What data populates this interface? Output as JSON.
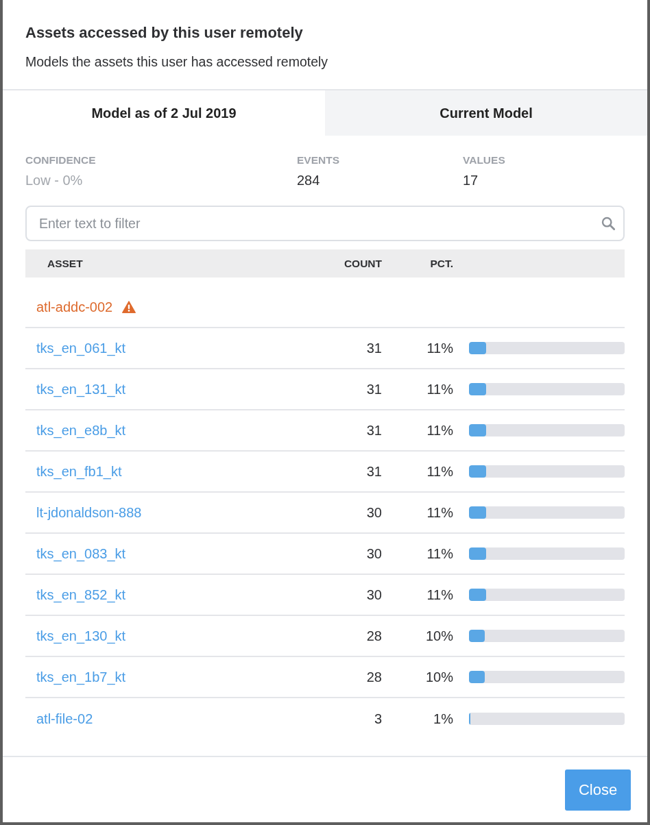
{
  "dialog": {
    "title": "Assets accessed by this user remotely",
    "subtitle": "Models the assets this user has accessed remotely"
  },
  "tabs": [
    {
      "label": "Model as of 2 Jul 2019",
      "selected": true
    },
    {
      "label": "Current Model",
      "selected": false
    }
  ],
  "stats": [
    {
      "label": "CONFIDENCE",
      "value": "Low - 0%",
      "muted": true
    },
    {
      "label": "EVENTS",
      "value": "284",
      "muted": false
    },
    {
      "label": "VALUES",
      "value": "17",
      "muted": false
    }
  ],
  "filter": {
    "placeholder": "Enter text to filter"
  },
  "table": {
    "columns": [
      "ASSET",
      "COUNT",
      "PCT."
    ],
    "rows": [
      {
        "asset": "atl-addc-002",
        "warning": true
      },
      {
        "asset": "tks_en_061_kt",
        "warning": false,
        "count": "31",
        "pct": "11%",
        "level": 0.11
      },
      {
        "asset": "tks_en_131_kt",
        "warning": false,
        "count": "31",
        "pct": "11%",
        "level": 0.11
      },
      {
        "asset": "tks_en_e8b_kt",
        "warning": false,
        "count": "31",
        "pct": "11%",
        "level": 0.11
      },
      {
        "asset": "tks_en_fb1_kt",
        "warning": false,
        "count": "31",
        "pct": "11%",
        "level": 0.11
      },
      {
        "asset": "lt-jdonaldson-888",
        "warning": false,
        "count": "30",
        "pct": "11%",
        "level": 0.11
      },
      {
        "asset": "tks_en_083_kt",
        "warning": false,
        "count": "30",
        "pct": "11%",
        "level": 0.11
      },
      {
        "asset": "tks_en_852_kt",
        "warning": false,
        "count": "30",
        "pct": "11%",
        "level": 0.11
      },
      {
        "asset": "tks_en_130_kt",
        "warning": false,
        "count": "28",
        "pct": "10%",
        "level": 0.1
      },
      {
        "asset": "tks_en_1b7_kt",
        "warning": false,
        "count": "28",
        "pct": "10%",
        "level": 0.1
      },
      {
        "asset": "atl-file-02",
        "warning": false,
        "count": "3",
        "pct": "1%",
        "level": 0.01
      }
    ]
  },
  "buttons": [
    {
      "label": "Close"
    }
  ]
}
